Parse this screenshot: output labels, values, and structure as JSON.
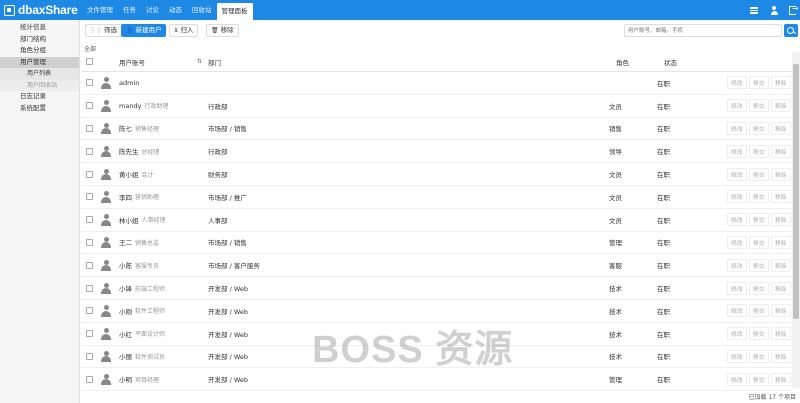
{
  "app": {
    "logo_text": "dbaxShare"
  },
  "nav": {
    "tabs": [
      {
        "label": "文件管理"
      },
      {
        "label": "任务"
      },
      {
        "label": "讨论"
      },
      {
        "label": "动态"
      },
      {
        "label": "回收站"
      },
      {
        "label": "管理面板"
      }
    ],
    "active_tab": "管理面板",
    "icons": [
      "menu-icon",
      "user-icon",
      "logout-icon"
    ]
  },
  "sidebar": {
    "items": [
      {
        "label": "统计信息"
      },
      {
        "label": "部门结构"
      },
      {
        "label": "角色分组"
      },
      {
        "label": "用户管理"
      },
      {
        "label": "用户列表"
      },
      {
        "label": "用户回收站"
      },
      {
        "label": "日志记录"
      },
      {
        "label": "系统配置"
      }
    ]
  },
  "toolbar": {
    "filter_label": "筛选",
    "new_user_label": "新建用户",
    "import_label": "归入",
    "remove_label": "移除",
    "search_placeholder": "用户账号、邮箱、手机"
  },
  "table": {
    "all_label": "全部",
    "headers": {
      "account": "用户账号",
      "dept": "部门",
      "role": "角色",
      "status": "状态"
    },
    "actions": {
      "edit": "修改",
      "transfer": "移交",
      "remove": "移除"
    },
    "rows": [
      {
        "name": "admin",
        "title": "",
        "dept": "",
        "role": "",
        "status": "在职"
      },
      {
        "name": "mandy",
        "title": "行政助理",
        "dept": "行政部",
        "role": "文员",
        "status": "在职"
      },
      {
        "name": "陈七",
        "title": "销售经理",
        "dept": "市场部 / 销售",
        "role": "销售",
        "status": "在职"
      },
      {
        "name": "陈先生",
        "title": "总经理",
        "dept": "行政部",
        "role": "领导",
        "status": "在职"
      },
      {
        "name": "黄小姐",
        "title": "会计",
        "dept": "财务部",
        "role": "文员",
        "status": "在职"
      },
      {
        "name": "李四",
        "title": "营销助理",
        "dept": "市场部 / 推广",
        "role": "文员",
        "status": "在职"
      },
      {
        "name": "林小姐",
        "title": "人事经理",
        "dept": "人事部",
        "role": "文员",
        "status": "在职"
      },
      {
        "name": "王二",
        "title": "销售总监",
        "dept": "市场部 / 销售",
        "role": "管理",
        "status": "在职"
      },
      {
        "name": "小陈",
        "title": "客服专员",
        "dept": "市场部 / 客户服务",
        "role": "客服",
        "status": "在职"
      },
      {
        "name": "小锋",
        "title": "前端工程师",
        "dept": "开发部 / Web",
        "role": "技术",
        "status": "在职"
      },
      {
        "name": "小刚",
        "title": "软件工程师",
        "dept": "开发部 / Web",
        "role": "技术",
        "status": "在职"
      },
      {
        "name": "小红",
        "title": "平面设计师",
        "dept": "开发部 / Web",
        "role": "技术",
        "status": "在职"
      },
      {
        "name": "小丽",
        "title": "软件测试员",
        "dept": "开发部 / Web",
        "role": "技术",
        "status": "在职"
      },
      {
        "name": "小明",
        "title": "项目经理",
        "dept": "开发部 / Web",
        "role": "管理",
        "status": "在职"
      }
    ]
  },
  "footer": {
    "status_text": "已加载 17 个项目"
  },
  "watermark": "BOSS 资源",
  "colors": {
    "accent": "#1e88e5",
    "sidebar_bg": "#f5f5f5",
    "sidebar_active": "#cfcfcf"
  }
}
